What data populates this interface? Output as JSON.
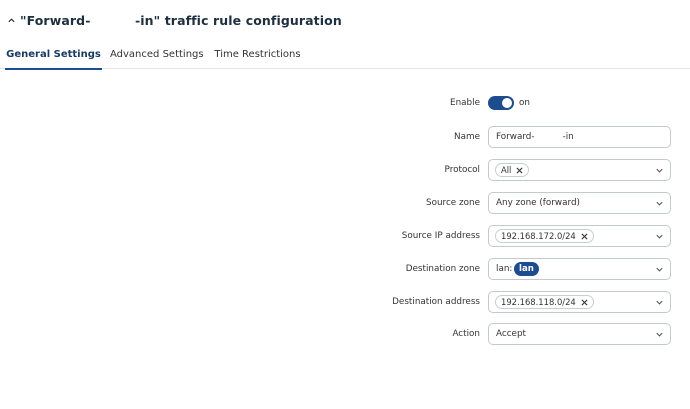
{
  "header": {
    "title": "\"Forward-          -in\" traffic rule configuration",
    "collapse_icon": "chevron-up-icon"
  },
  "tabs": [
    {
      "label": "General Settings",
      "active": true
    },
    {
      "label": "Advanced Settings",
      "active": false
    },
    {
      "label": "Time Restrictions",
      "active": false
    }
  ],
  "form": {
    "enable": {
      "label": "Enable",
      "state_text": "on",
      "checked": true
    },
    "name": {
      "label": "Name",
      "value": "Forward-          -in"
    },
    "protocol": {
      "label": "Protocol",
      "chips": [
        "All"
      ]
    },
    "source_zone": {
      "label": "Source zone",
      "value": "Any zone (forward)"
    },
    "source_ip": {
      "label": "Source IP address",
      "chips": [
        "192.168.172.0/24"
      ]
    },
    "destination_zone": {
      "label": "Destination zone",
      "prefix": "lan:",
      "badge": "lan"
    },
    "destination_address": {
      "label": "Destination address",
      "chips": [
        "192.168.118.0/24"
      ]
    },
    "action": {
      "label": "Action",
      "value": "Accept"
    }
  },
  "colors": {
    "accent": "#1d4d8f",
    "border": "#c4c9cf",
    "text": "#333333"
  }
}
